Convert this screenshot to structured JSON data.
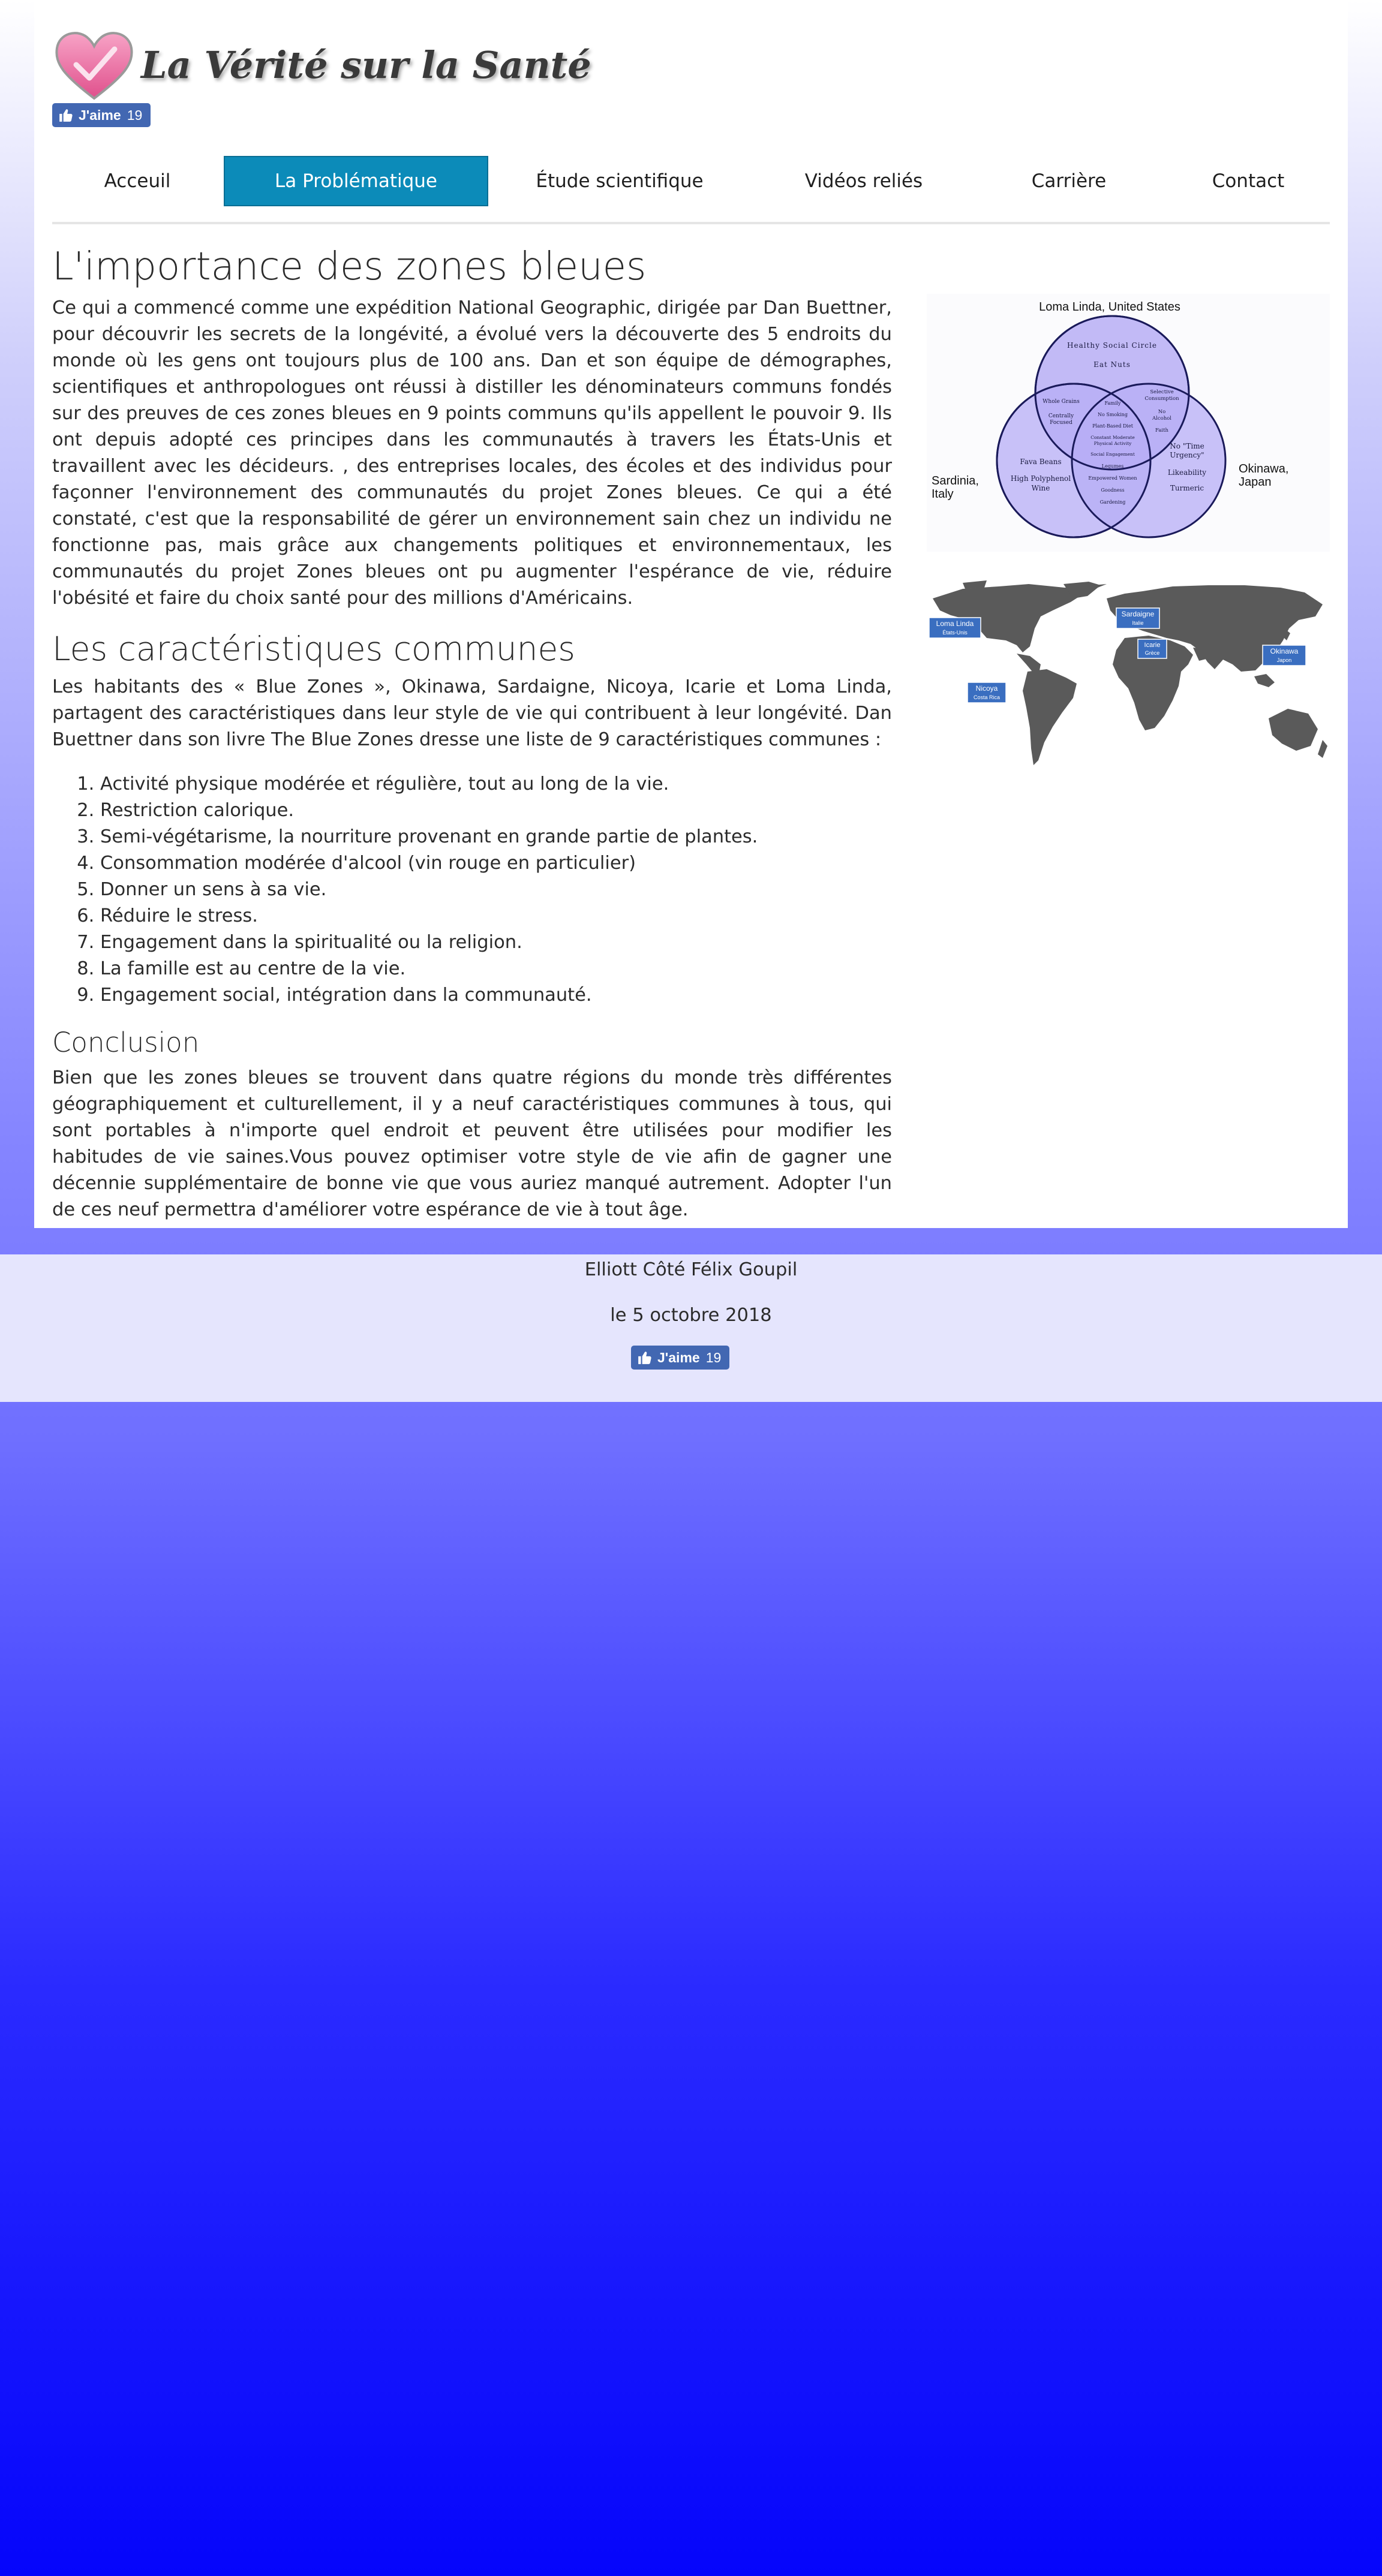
{
  "header": {
    "site_title": "La Vérité sur la Santé",
    "like_label": "J'aime",
    "like_count": "19"
  },
  "nav": {
    "items": [
      {
        "label": "Acceuil",
        "active": false
      },
      {
        "label": "La Problématique",
        "active": true
      },
      {
        "label": "Étude scientifique",
        "active": false
      },
      {
        "label": "Vidéos reliés",
        "active": false
      },
      {
        "label": "Carrière",
        "active": false
      },
      {
        "label": "Contact",
        "active": false
      }
    ]
  },
  "main": {
    "h1": "L'importance des zones bleues",
    "p1": "Ce qui a commencé comme une expédition National Geographic, dirigée par Dan Buettner, pour découvrir les secrets de la longévité, a évolué vers la découverte des 5 endroits du monde où les gens ont toujours plus de 100 ans. Dan et son équipe de démographes, scientifiques et anthropologues ont réussi à distiller les dénominateurs communs fondés sur des preuves de ces zones bleues en 9 points communs qu'ils appellent le pouvoir 9. Ils ont depuis adopté ces principes dans les communautés à travers les États-Unis et travaillent avec les décideurs. , des entreprises locales, des écoles et des individus pour façonner l'environnement des communautés du projet Zones bleues. Ce qui a été constaté, c'est que la responsabilité de gérer un environnement sain chez un individu ne fonctionne pas, mais grâce aux changements politiques et environnementaux, les communautés du projet Zones bleues ont pu augmenter l'espérance de vie, réduire l'obésité et faire du choix santé pour des millions d'Américains.",
    "h2": "Les caractéristiques communes",
    "p2": "Les habitants des « Blue Zones », Okinawa, Sardaigne, Nicoya, Icarie et Loma Linda, partagent des caractéristiques dans leur style de vie qui contribuent à leur longévité. Dan Buettner dans son livre The Blue Zones dresse une liste de 9 caractéristiques communes :",
    "list": [
      "Activité physique modérée et régulière, tout au long de la vie.",
      "Restriction calorique.",
      "Semi-végétarisme, la nourriture provenant en grande partie de plantes.",
      "Consommation modérée d'alcool (vin rouge en particulier)",
      "Donner un sens à sa vie.",
      "Réduire le stress.",
      "Engagement dans la spiritualité ou la religion.",
      "La famille est au centre de la vie.",
      "Engagement social, intégration dans la communauté."
    ],
    "h3": "Conclusion",
    "p3": "Bien que les zones bleues se trouvent dans quatre régions du monde très différentes géographiquement et culturellement, il y a neuf caractéristiques communes à tous, qui sont portables à n'importe quel endroit et peuvent être utilisées pour modifier les habitudes de vie saines.Vous pouvez optimiser votre style de vie afin de gagner une décennie supplémentaire de bonne vie que vous auriez manqué autrement. Adopter l'un de ces neuf permettra d'améliorer votre espérance de vie à tout âge."
  },
  "venn": {
    "top_label": "Loma Linda, United States",
    "left_label_1": "Sardinia,",
    "left_label_2": "Italy",
    "right_label_1": "Okinawa,",
    "right_label_2": "Japan",
    "top_items": [
      "Healthy Social Circle",
      "Eat Nuts"
    ],
    "left_items": [
      "Fava Beans",
      "High Polyphenol",
      "Wine"
    ],
    "right_items": [
      "No \"Time",
      "Urgency\"",
      "Likeability",
      "Turmeric"
    ],
    "lw_items": [
      "Whole Grains",
      "Centrally",
      "Focused"
    ],
    "rw_items": [
      "Selective",
      "Consumption",
      "No",
      "Alcohol",
      "Faith"
    ],
    "center_items": [
      "Family",
      "No Smoking",
      "Plant-Based Diet",
      "Constant Moderate",
      "Physical Activity",
      "Social Engagement"
    ],
    "bottom_items": [
      "Legumes",
      "Empowered Women",
      "Goodness",
      "Gardening"
    ],
    "fill_color": "#b7aef5",
    "stroke_color": "#1a1a5a"
  },
  "map": {
    "labels": [
      {
        "name": "Loma Linda",
        "sub": "États-Unis"
      },
      {
        "name": "Sardaigne",
        "sub": "Italie"
      },
      {
        "name": "Icarie",
        "sub": "Grèce"
      },
      {
        "name": "Okinawa",
        "sub": "Japon"
      },
      {
        "name": "Nicoya",
        "sub": "Costa Rica"
      }
    ],
    "land_color": "#5a5a5a",
    "label_color": "#3a6ec0"
  },
  "footer": {
    "authors": "Elliott Côté Félix Goupil",
    "date": "le 5 octobre 2018"
  },
  "colors": {
    "nav_active": "#0c8bb9",
    "facebook": "#4267b2",
    "footer_bg": "#e5e5fd"
  }
}
